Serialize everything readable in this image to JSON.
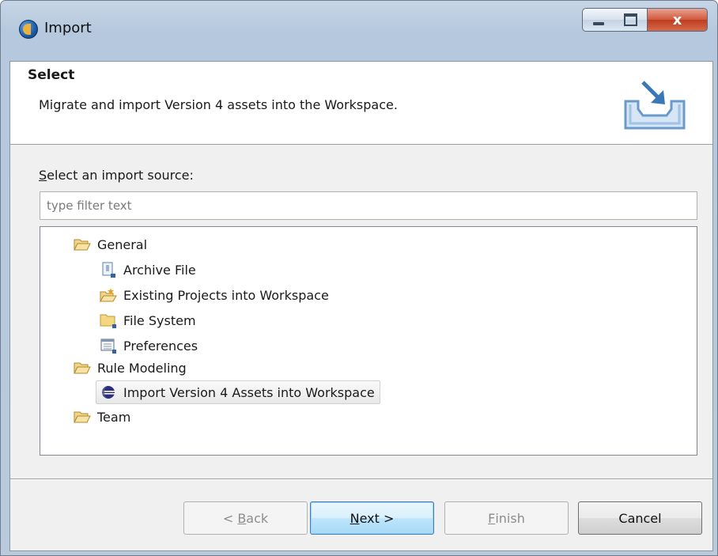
{
  "window": {
    "title": "Import",
    "close_glyph": "x"
  },
  "banner": {
    "title": "Select",
    "description": "Migrate and import Version 4 assets into the Workspace.",
    "icon": "import-tray-icon"
  },
  "source_label": {
    "mnemonic": "S",
    "rest": "elect an import source:"
  },
  "filter": {
    "placeholder": "type filter text",
    "value": ""
  },
  "tree": [
    {
      "label": "General",
      "icon": "open-folder-icon",
      "level": 0
    },
    {
      "label": "Archive File",
      "icon": "archive-file-icon",
      "level": 1
    },
    {
      "label": "Existing Projects into Workspace",
      "icon": "project-folder-icon",
      "level": 1
    },
    {
      "label": "File System",
      "icon": "folder-icon",
      "level": 1
    },
    {
      "label": "Preferences",
      "icon": "preferences-icon",
      "level": 1
    },
    {
      "label": "Rule Modeling",
      "icon": "open-folder-icon",
      "level": 0
    },
    {
      "label": "Import Version 4 Assets into Workspace",
      "icon": "eclipse-globe-icon",
      "level": 1,
      "selected": true
    },
    {
      "label": "Team",
      "icon": "open-folder-icon",
      "level": 0
    }
  ],
  "buttons": {
    "back": {
      "prefix": "< ",
      "mnemonic": "B",
      "rest": "ack",
      "enabled": false
    },
    "next": {
      "mnemonic": "N",
      "rest": "ext >",
      "enabled": true
    },
    "finish": {
      "mnemonic": "F",
      "rest": "inish",
      "enabled": false
    },
    "cancel": {
      "label": "Cancel",
      "enabled": true
    }
  }
}
